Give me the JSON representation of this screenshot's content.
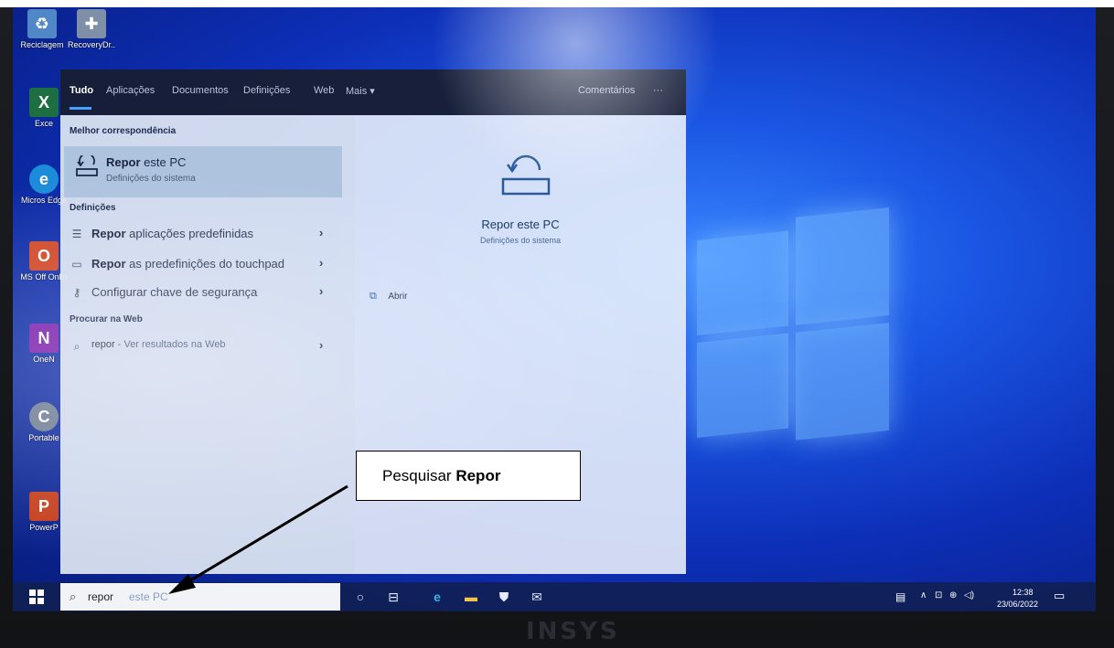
{
  "desktop_icons": [
    {
      "label": "Reciclagem",
      "icon": "recycle-bin-icon"
    },
    {
      "label": "RecoveryDr...",
      "icon": "recovery-drive-icon"
    },
    {
      "label": "Exce",
      "icon": "excel-icon"
    },
    {
      "label": "Micros Edge",
      "icon": "edge-icon"
    },
    {
      "label": "MS Off Onlin",
      "icon": "office-icon"
    },
    {
      "label": "OneN",
      "icon": "onenote-icon"
    },
    {
      "label": "Portable",
      "icon": "portable-icon"
    },
    {
      "label": "PowerP",
      "icon": "powerpoint-icon"
    }
  ],
  "search_panel": {
    "tabs": [
      "Tudo",
      "Aplicações",
      "Documentos",
      "Definições",
      "Web",
      "Mais ▾"
    ],
    "feedback": "Comentários",
    "more": "···",
    "best_match_header": "Melhor correspondência",
    "best_match": {
      "title_bold": "Repor",
      "title_rest": " este PC",
      "subtitle": "Definições do sistema"
    },
    "settings_header": "Definições",
    "settings_items": [
      {
        "bold": "Repor",
        "rest": " aplicações predefinidas",
        "icon": "list-icon"
      },
      {
        "bold": "Repor",
        "rest": " as predefinições do touchpad",
        "icon": "touchpad-icon"
      },
      {
        "bold": "",
        "rest": "Configurar chave de segurança",
        "icon": "key-icon"
      }
    ],
    "web_header": "Procurar na Web",
    "web_item": {
      "query": "repor",
      "suffix": " - Ver resultados na Web"
    },
    "preview": {
      "title": "Repor este PC",
      "subtitle": "Definições do sistema",
      "open_label": "Abrir"
    }
  },
  "taskbar": {
    "search_typed": "repor",
    "search_ghost": " este PC",
    "time": "12:38",
    "date": "23/06/2022"
  },
  "callout": {
    "text": "Pesquisar ",
    "bold": "Repor"
  },
  "bezel_logo": "INSYS",
  "colors": {
    "accent": "#4aa0ff",
    "desktop_blue": "#1a56e3",
    "taskbar": "#102054"
  }
}
